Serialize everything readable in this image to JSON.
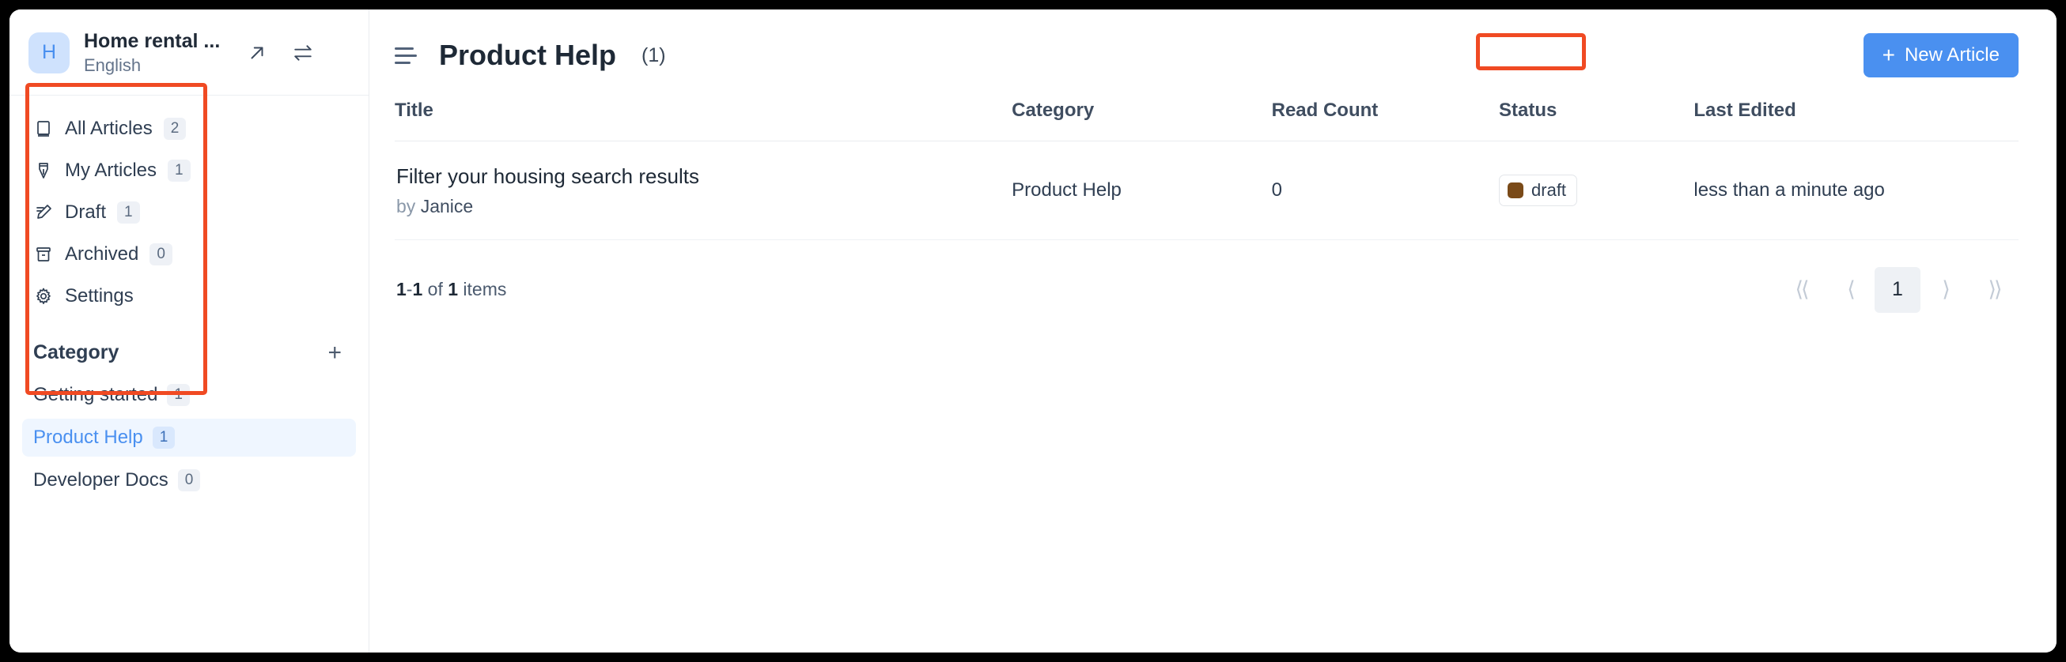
{
  "workspace": {
    "avatar_letter": "H",
    "name": "Home rental ...",
    "language": "English",
    "open_icon": "arrow-up-right-icon",
    "switch_icon": "switch-arrows-icon"
  },
  "sidebar": {
    "nav_items": [
      {
        "label": "All Articles",
        "count": "2",
        "icon": "book-icon"
      },
      {
        "label": "My Articles",
        "count": "1",
        "icon": "pen-nib-icon"
      },
      {
        "label": "Draft",
        "count": "1",
        "icon": "pencil-lines-icon"
      },
      {
        "label": "Archived",
        "count": "0",
        "icon": "archive-box-icon"
      },
      {
        "label": "Settings",
        "count": "",
        "icon": "gear-icon"
      }
    ],
    "category_title": "Category",
    "add_category_label": "+",
    "categories": [
      {
        "label": "Getting started",
        "count": "1",
        "active": false
      },
      {
        "label": "Product Help",
        "count": "1",
        "active": true
      },
      {
        "label": "Developer Docs",
        "count": "0",
        "active": false
      }
    ]
  },
  "main": {
    "menu_icon": "hamburger-menu-icon",
    "page_title": "Product Help",
    "page_count": "(1)",
    "new_article_label": "New Article",
    "new_article_plus": "+"
  },
  "table": {
    "headers": {
      "title": "Title",
      "category": "Category",
      "read_count": "Read Count",
      "status": "Status",
      "last_edited": "Last Edited"
    },
    "rows": [
      {
        "title": "Filter your housing search results",
        "by_prefix": "by",
        "author": "Janice",
        "category": "Product Help",
        "read_count": "0",
        "status": "draft",
        "status_color": "#7a4a18",
        "last_edited": "less than a minute ago"
      }
    ]
  },
  "footer": {
    "range_start": "1",
    "range_sep": "-",
    "range_end": "1",
    "of_text": "of",
    "total": "1",
    "items_text": "items",
    "pager": {
      "first": "⟨⟨",
      "prev": "⟨",
      "current": "1",
      "next": "⟩",
      "last": "⟩⟩"
    }
  },
  "colors": {
    "accent": "#4a90f0",
    "annotation": "#f04a23",
    "avatar_bg": "#cfe2fd",
    "draft_badge": "#7a4a18"
  }
}
